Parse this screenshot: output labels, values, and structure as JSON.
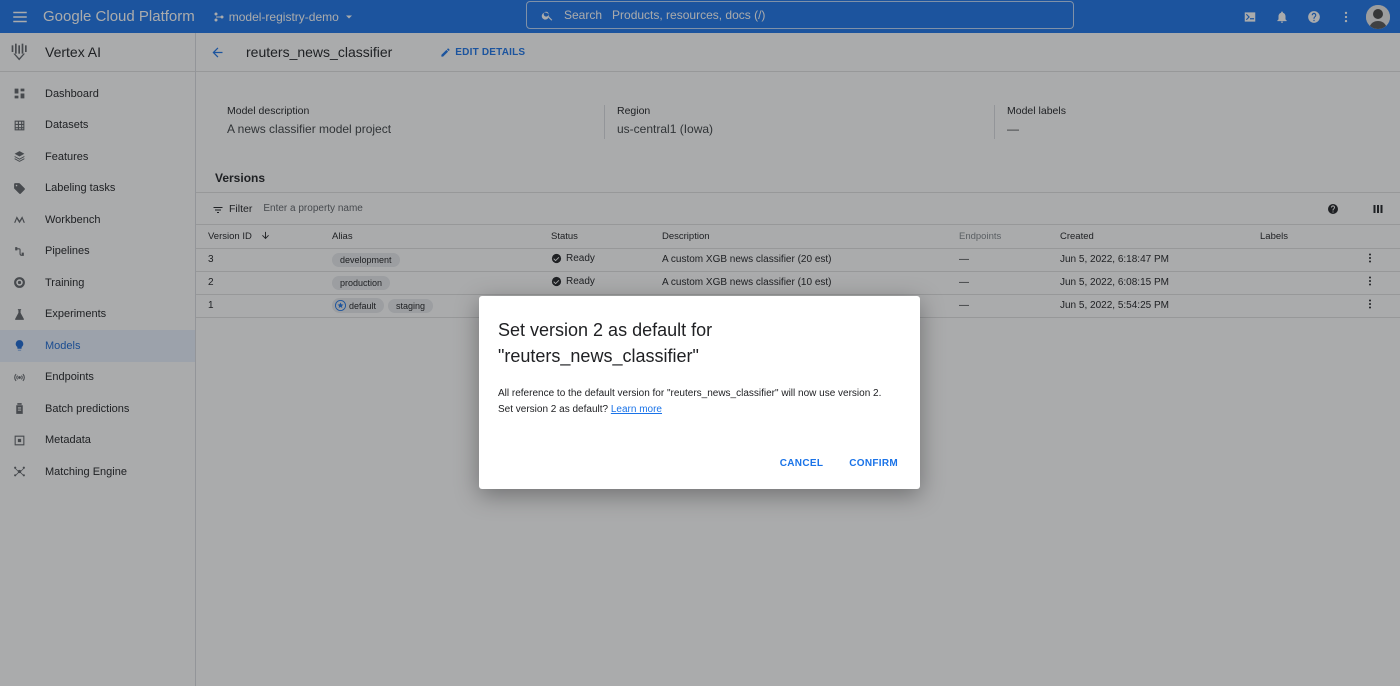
{
  "topbar": {
    "title": "Google Cloud Platform",
    "project": "model-registry-demo",
    "search_label": "Search",
    "search_placeholder": "Products, resources, docs (/)"
  },
  "sidebar": {
    "product": "Vertex AI",
    "items": [
      {
        "label": "Dashboard",
        "icon": "dashboard-icon"
      },
      {
        "label": "Datasets",
        "icon": "datasets-icon"
      },
      {
        "label": "Features",
        "icon": "features-icon"
      },
      {
        "label": "Labeling tasks",
        "icon": "label-icon"
      },
      {
        "label": "Workbench",
        "icon": "workbench-icon"
      },
      {
        "label": "Pipelines",
        "icon": "pipelines-icon"
      },
      {
        "label": "Training",
        "icon": "training-icon"
      },
      {
        "label": "Experiments",
        "icon": "flask-icon"
      },
      {
        "label": "Models",
        "icon": "lightbulb-icon"
      },
      {
        "label": "Endpoints",
        "icon": "endpoints-icon"
      },
      {
        "label": "Batch predictions",
        "icon": "batch-icon"
      },
      {
        "label": "Metadata",
        "icon": "metadata-icon"
      },
      {
        "label": "Matching Engine",
        "icon": "matching-icon"
      }
    ],
    "active_index": 8
  },
  "header": {
    "model_name": "reuters_news_classifier",
    "edit_label": "EDIT DETAILS"
  },
  "info": {
    "description_label": "Model description",
    "description_value": "A news classifier model project",
    "region_label": "Region",
    "region_value": "us-central1 (Iowa)",
    "labels_label": "Model labels",
    "labels_value": "—"
  },
  "versions": {
    "title": "Versions",
    "filter_label": "Filter",
    "filter_placeholder": "Enter a property name",
    "columns": [
      "Version ID",
      "Alias",
      "Status",
      "Description",
      "Endpoints",
      "Created",
      "Labels"
    ],
    "rows": [
      {
        "id": "3",
        "aliases": [
          "development"
        ],
        "default": false,
        "status": "Ready",
        "description": "A custom XGB news classifier (20 est)",
        "endpoints": "—",
        "created": "Jun 5, 2022, 6:18:47 PM",
        "labels": ""
      },
      {
        "id": "2",
        "aliases": [
          "production"
        ],
        "default": false,
        "status": "Ready",
        "description": "A custom XGB news classifier (10 est)",
        "endpoints": "—",
        "created": "Jun 5, 2022, 6:08:15 PM",
        "labels": ""
      },
      {
        "id": "1",
        "aliases": [
          "default",
          "staging"
        ],
        "default": true,
        "status": "",
        "description": "",
        "endpoints": "—",
        "created": "Jun 5, 2022, 5:54:25 PM",
        "labels": ""
      }
    ]
  },
  "dialog": {
    "title_line1": "Set version 2 as default for",
    "title_line2": "\"reuters_news_classifier\"",
    "body_line1": "All reference to the default version for \"reuters_news_classifier\" will now use version 2.",
    "body_line2": "Set version 2 as default?",
    "link": "Learn more",
    "cancel": "CANCEL",
    "confirm": "CONFIRM"
  },
  "colors": {
    "brand_blue": "#1a73e8",
    "active_nav_bg": "#e8f0fe",
    "ready_green": "#1e8e3e"
  }
}
